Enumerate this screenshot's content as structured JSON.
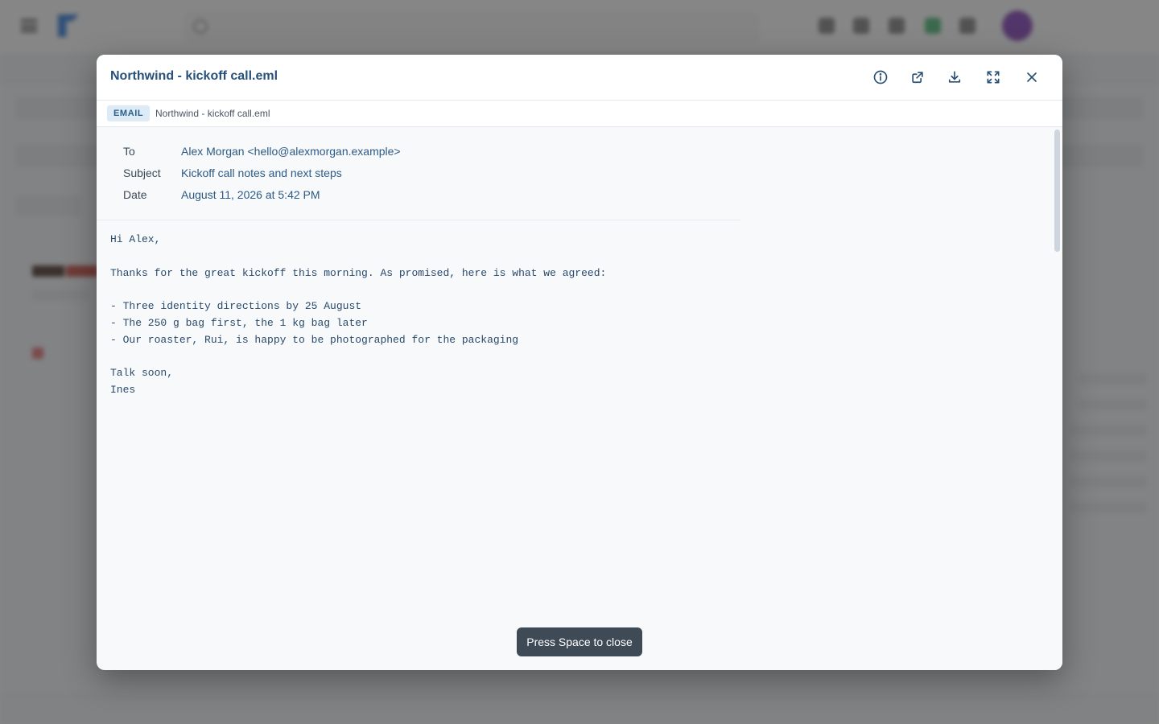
{
  "modal": {
    "title": "Northwind - kickoff call.eml",
    "type_badge": "EMAIL",
    "filename": "Northwind - kickoff call.eml",
    "actions": {
      "info": "info-icon",
      "open_external": "external-link-icon",
      "download": "download-icon",
      "fullscreen": "fullscreen-icon",
      "close": "close-icon"
    }
  },
  "email": {
    "headers": [
      {
        "label": "To",
        "value": "Alex Morgan <hello@alexmorgan.example>"
      },
      {
        "label": "Subject",
        "value": "Kickoff call notes and next steps"
      },
      {
        "label": "Date",
        "value": "August 11, 2026 at 5:42 PM"
      }
    ],
    "body": "Hi Alex,\n\nThanks for the great kickoff this morning. As promised, here is what we agreed:\n\n- Three identity directions by 25 August\n- The 250 g bag first, the 1 kg bag later\n- Our roaster, Rui, is happy to be photographed for the packaging\n\nTalk soon,\nInes"
  },
  "toast": {
    "text": "Press Space to close"
  },
  "colors": {
    "title": "#27517a",
    "badge_bg": "#dcebf6",
    "toast_bg": "#3f4a57"
  }
}
